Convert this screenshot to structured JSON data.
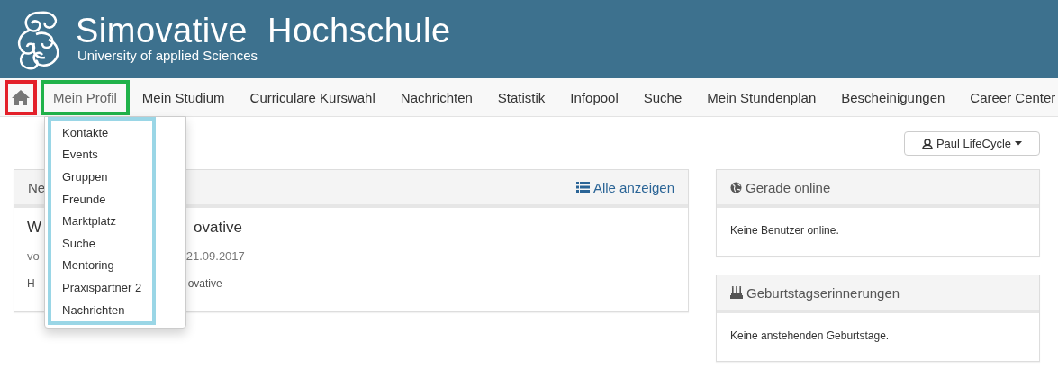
{
  "header": {
    "title": "Simovative  Hochschule",
    "subtitle": "University of applied Sciences"
  },
  "nav": {
    "items": [
      {
        "kind": "home",
        "selected": false,
        "color": "#e3202a"
      },
      {
        "kind": "link",
        "label": "Mein Profil",
        "selected": true,
        "color": "#20b24a"
      },
      {
        "kind": "link",
        "label": "Mein Studium",
        "selected": false
      },
      {
        "kind": "link",
        "label": "Curriculare Kurswahl",
        "selected": false
      },
      {
        "kind": "link",
        "label": "Nachrichten",
        "selected": false
      },
      {
        "kind": "link",
        "label": "Statistik",
        "selected": false
      },
      {
        "kind": "link",
        "label": "Infopool",
        "selected": false
      },
      {
        "kind": "link",
        "label": "Suche",
        "selected": false
      },
      {
        "kind": "link",
        "label": "Mein Stundenplan",
        "selected": false
      },
      {
        "kind": "link",
        "label": "Bescheinigungen",
        "selected": false
      },
      {
        "kind": "link",
        "label": "Career Center",
        "selected": false
      }
    ]
  },
  "dropdown": {
    "color": "#9ad6e6",
    "items": [
      "Kontakte",
      "Events",
      "Gruppen",
      "Freunde",
      "Marktplatz",
      "Suche",
      "Mentoring",
      "Praxispartner 2",
      "Nachrichten"
    ]
  },
  "user_menu": {
    "label": "Paul LifeCycle"
  },
  "news_panel": {
    "title": "Ne",
    "action": "Alle anzeigen",
    "headline": [
      "W",
      "ovative"
    ],
    "meta": [
      "vo",
      "21.09.2017"
    ],
    "text": [
      "H",
      "ovative"
    ]
  },
  "side_panels": [
    {
      "kind": "online",
      "title": "Gerade online",
      "text": "Keine Benutzer online."
    },
    {
      "kind": "birthdays",
      "title": "Geburtstagserinnerungen",
      "text": "Keine anstehenden Geburtstage."
    }
  ]
}
